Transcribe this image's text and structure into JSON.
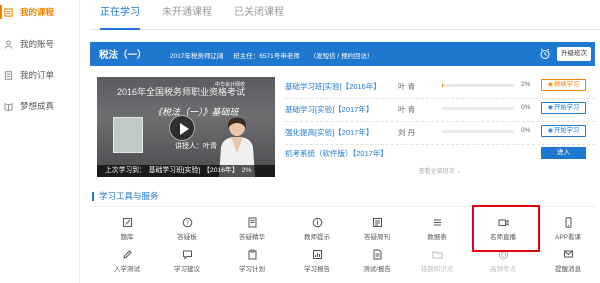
{
  "sidebar": {
    "items": [
      {
        "label": "我的课程",
        "icon": "book-icon",
        "active": true
      },
      {
        "label": "我的账号",
        "icon": "user-icon",
        "active": false
      },
      {
        "label": "我的订单",
        "icon": "order-icon",
        "active": false
      },
      {
        "label": "梦想成真",
        "icon": "book-open-icon",
        "active": false
      }
    ]
  },
  "tabs": [
    "正在学习",
    "未开通课程",
    "已关闭课程"
  ],
  "course": {
    "title": "税法（一）",
    "info": [
      "2017年税务师辽阔",
      "班主任：6571号申老师",
      "（发短信 / 预约回访）"
    ],
    "upgrade_label": "升级班次"
  },
  "video": {
    "year_title": "2016年全国税务师职业资格考试",
    "book_title": "《税法（一）》基础班",
    "teacher": "讲授人：叶青",
    "logo": "中华会计网校",
    "last_prefix": "上次学习到：",
    "last_class": "基础学习班[实验]",
    "last_year": "【2016年】",
    "last_pct": "2%"
  },
  "classes": [
    {
      "name": "基础学习班[实验]【2016年】",
      "teacher": "叶  青",
      "progress": 0.02,
      "pct": "2%",
      "button": "继续学习",
      "style": "orange"
    },
    {
      "name": "基础学习[实验]【2017年】",
      "teacher": "叶  青",
      "progress": 0,
      "pct": "0%",
      "button": "开始学习",
      "style": "blue"
    },
    {
      "name": "强化提高[实验]【2017年】",
      "teacher": "刘  丹",
      "progress": 0,
      "pct": "0%",
      "button": "开始学习",
      "style": "blue"
    },
    {
      "name": "机考系统（软件版）【2017年】",
      "teacher": "",
      "progress": null,
      "pct": "",
      "button": "进入",
      "style": "solid"
    }
  ],
  "view_all": "查看全部班次",
  "tools_header": "学习工具与服务",
  "tools": [
    {
      "label": "题库",
      "icon": "edit-icon"
    },
    {
      "label": "答疑板",
      "icon": "question-icon"
    },
    {
      "label": "答疑精华",
      "icon": "bookmark-icon"
    },
    {
      "label": "教师提示",
      "icon": "info-icon"
    },
    {
      "label": "答疑周刊",
      "icon": "newspaper-icon"
    },
    {
      "label": "数据表",
      "icon": "list-icon"
    },
    {
      "label": "名师直播",
      "icon": "video-camera-icon"
    },
    {
      "label": "APP看课",
      "icon": "phone-icon"
    },
    {
      "label": "入学测试",
      "icon": "pencil-icon"
    },
    {
      "label": "学习建议",
      "icon": "chat-icon"
    },
    {
      "label": "学习计划",
      "icon": "clipboard-icon"
    },
    {
      "label": "学习报告",
      "icon": "chart-icon"
    },
    {
      "label": "测试/报告",
      "icon": "document-icon"
    },
    {
      "label": "错题知识点",
      "icon": "folder-icon",
      "dim": true
    },
    {
      "label": "高频考点",
      "icon": "target-icon",
      "dim": true
    },
    {
      "label": "提醒消息",
      "icon": "message-icon"
    }
  ],
  "colors": {
    "accent": "#1f78d0",
    "active": "#f08300",
    "highlight": "#e3000f"
  }
}
